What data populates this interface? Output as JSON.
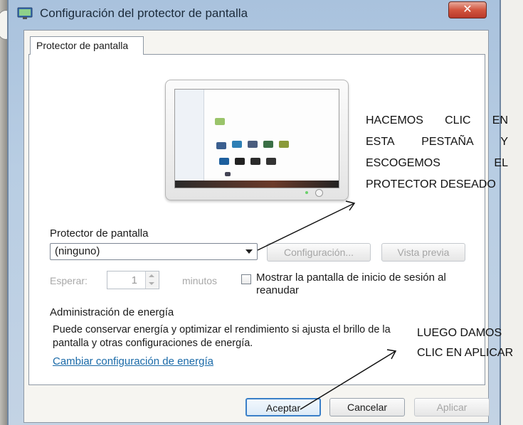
{
  "window": {
    "title": "Configuración del protector de pantalla",
    "close_label": "✕"
  },
  "tabs": [
    {
      "label": "Protector de pantalla"
    }
  ],
  "screensaver": {
    "section_label": "Protector de pantalla",
    "selected": "(ninguno)",
    "settings_button": "Configuración...",
    "preview_button": "Vista previa",
    "wait_label": "Esperar:",
    "wait_value": "1",
    "minutes_label": "minutos",
    "resume_checkbox_label": "Mostrar la pantalla de inicio de sesión al reanudar"
  },
  "power": {
    "section_label": "Administración de energía",
    "description": "Puede conservar energía y optimizar el rendimiento si ajusta el brillo de la pantalla y otras configuraciones de energía.",
    "link": "Cambiar configuración de energía"
  },
  "buttons": {
    "ok": "Aceptar",
    "cancel": "Cancelar",
    "apply": "Aplicar"
  },
  "annotations": {
    "note1_lines": [
      [
        "HACEMOS",
        "CLIC",
        "EN"
      ],
      [
        "ESTA",
        "PESTAÑA",
        "Y"
      ],
      [
        "ESCOGEMOS",
        "EL"
      ],
      [
        "PROTECTOR DESEADO"
      ]
    ],
    "note2_lines": [
      "LUEGO DAMOS",
      "CLIC EN APLICAR"
    ]
  },
  "colors": {
    "link": "#1a6aa8",
    "close_button": "#c8402f",
    "titlebar": "#b8cde3",
    "default_button_border": "#3a7fc8"
  }
}
